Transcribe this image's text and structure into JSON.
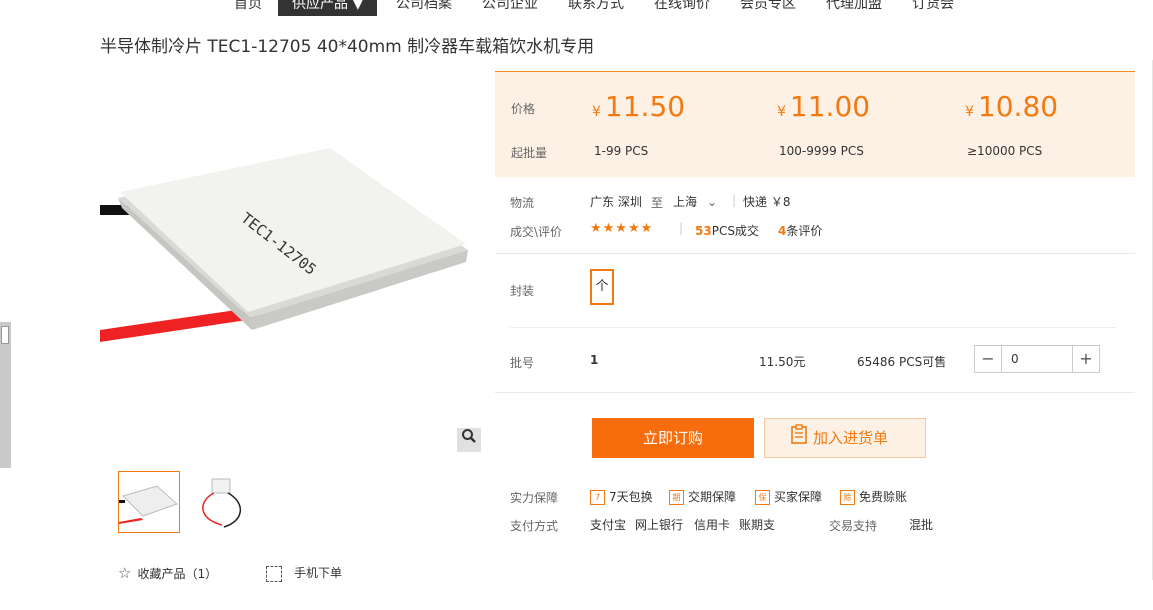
{
  "nav": {
    "items": [
      "首页",
      "供应产品 ▼",
      "公司档案",
      "公司企业",
      "联系方式",
      "在线询价",
      "会员专区",
      "代理加盟",
      "订货会"
    ]
  },
  "product": {
    "title": "半导体制冷片 TEC1-12705 40*40mm 制冷器车载箱饮水机专用",
    "image_text": "TEC1-12705"
  },
  "pricing": {
    "price_label": "价格",
    "moq_label": "起批量",
    "currency": "¥",
    "tiers": [
      {
        "price": "11.50",
        "qty": "1-99  PCS"
      },
      {
        "price": "11.00",
        "qty": "100-9999  PCS"
      },
      {
        "price": "10.80",
        "qty": "≥10000  PCS"
      }
    ]
  },
  "logistics": {
    "label": "物流",
    "from": "广东 深圳",
    "to_word": "至",
    "to": "上海",
    "express": "快递 ￥8"
  },
  "deals": {
    "label": "成交\\评价",
    "stars": "★★★★★",
    "deal_count": "53",
    "deal_suffix": "PCS成交",
    "review_count": "4",
    "review_suffix": "条评价"
  },
  "package": {
    "label": "封装",
    "option": "个"
  },
  "batch": {
    "label": "批号",
    "value": "1",
    "price": "11.50元",
    "stock": "65486 PCS可售",
    "quantity": "0"
  },
  "actions": {
    "buy_now": "立即订购",
    "add_to_list": "加入进货单"
  },
  "guarantees": {
    "label": "实力保障",
    "items": [
      {
        "icon": "7",
        "text": "7天包换"
      },
      {
        "icon": "期",
        "text": "交期保障"
      },
      {
        "icon": "保",
        "text": "买家保障"
      },
      {
        "icon": "赊",
        "text": "免费赊账"
      }
    ]
  },
  "payment": {
    "label": "支付方式",
    "methods": [
      "支付宝",
      "网上银行",
      "信用卡",
      "账期支"
    ],
    "trade_label": "交易支持",
    "trade_value": "混批"
  },
  "footer_links": {
    "favorite": "收藏产品（1）",
    "mobile": "手机下单"
  },
  "colors": {
    "accent": "#f27a10",
    "buy_button": "#f76c0c",
    "price_bg": "#fdf1e6"
  }
}
